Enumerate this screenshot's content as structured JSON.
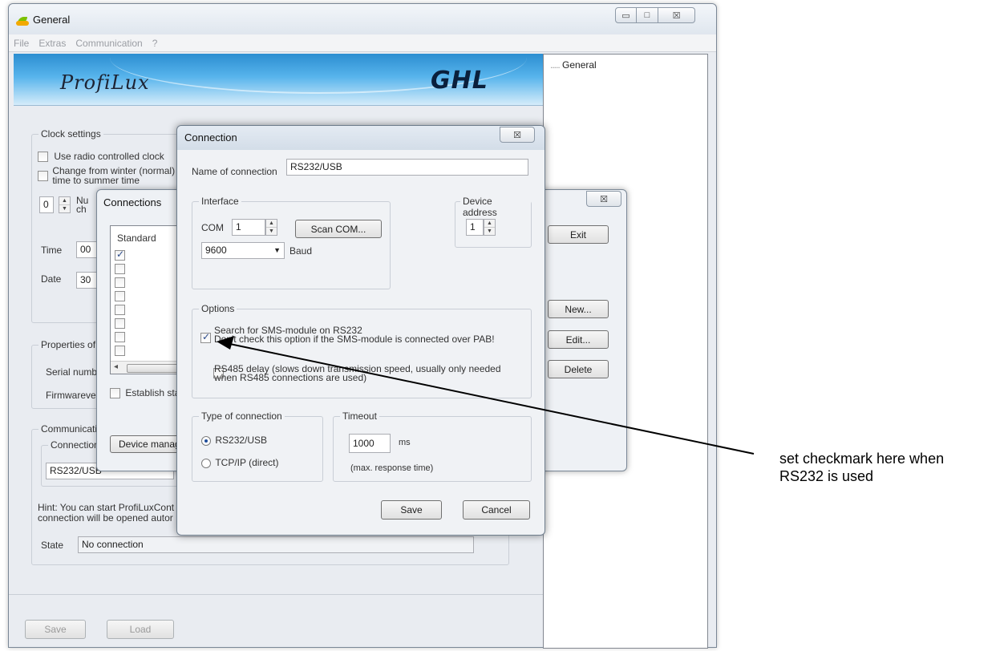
{
  "window": {
    "title": "General",
    "controls": {
      "minimize": "▭",
      "maximize": "□",
      "close": "☒"
    }
  },
  "menu": [
    "File",
    "Extras",
    "Communication",
    "?"
  ],
  "banner": {
    "left_logo": "ProfiLux",
    "right_logo": "GHL"
  },
  "tree": {
    "item": "General"
  },
  "clock": {
    "title": "Clock settings",
    "radio_clock": "Use radio controlled clock",
    "dst_line1": "Change from winter (normal)",
    "dst_line2": "time to summer time",
    "spin_value": "0",
    "num_label_line1": "Nu",
    "num_label_line2": "ch",
    "time_label": "Time",
    "time_value": "00",
    "date_label": "Date",
    "date_value": "30"
  },
  "properties": {
    "title": "Properties of",
    "serial_label": "Serial numb",
    "firmware_label": "Firmwareve"
  },
  "communication": {
    "title": "Communicati",
    "connection_label": "Connection",
    "connection_value": "RS232/USB",
    "hint_line1": "Hint: You can start ProfiLuxCont",
    "hint_line2": "connection will be opened autor",
    "state_label": "State",
    "state_value": "No connection"
  },
  "bottom": {
    "save": "Save",
    "load": "Load"
  },
  "connections_dialog": {
    "title": "Connections",
    "close": "☒",
    "column_header": "Standard",
    "rows": [
      true,
      false,
      false,
      false,
      false,
      false,
      false,
      false
    ],
    "establish": "Establish sta",
    "device_manager": "Device manag",
    "exit": "Exit",
    "new": "New...",
    "edit": "Edit...",
    "delete": "Delete"
  },
  "connection_dialog": {
    "title": "Connection",
    "close": "☒",
    "name_label": "Name of connection",
    "name_value": "RS232/USB",
    "interface_title": "Interface",
    "com_label": "COM",
    "com_value": "1",
    "scan_button": "Scan COM...",
    "baud_value": "9600",
    "baud_label": "Baud",
    "device_address_title": "Device address",
    "device_address_value": "1",
    "options_title": "Options",
    "sms_line1": "Search for SMS-module on RS232",
    "sms_line2": "Don't check this option if the SMS-module is connected over PAB!",
    "rs485_line1": "RS485 delay (slows down transmission speed, usually only needed",
    "rs485_line2": "when RS485 connections are used)",
    "type_title": "Type of connection",
    "type_rs232": "RS232/USB",
    "type_tcp": "TCP/IP (direct)",
    "timeout_title": "Timeout",
    "timeout_value": "1000",
    "timeout_unit": "ms",
    "timeout_note": "(max. response time)",
    "save": "Save",
    "cancel": "Cancel"
  },
  "callout": {
    "line1": "set checkmark here when",
    "line2": "RS232 is used"
  }
}
